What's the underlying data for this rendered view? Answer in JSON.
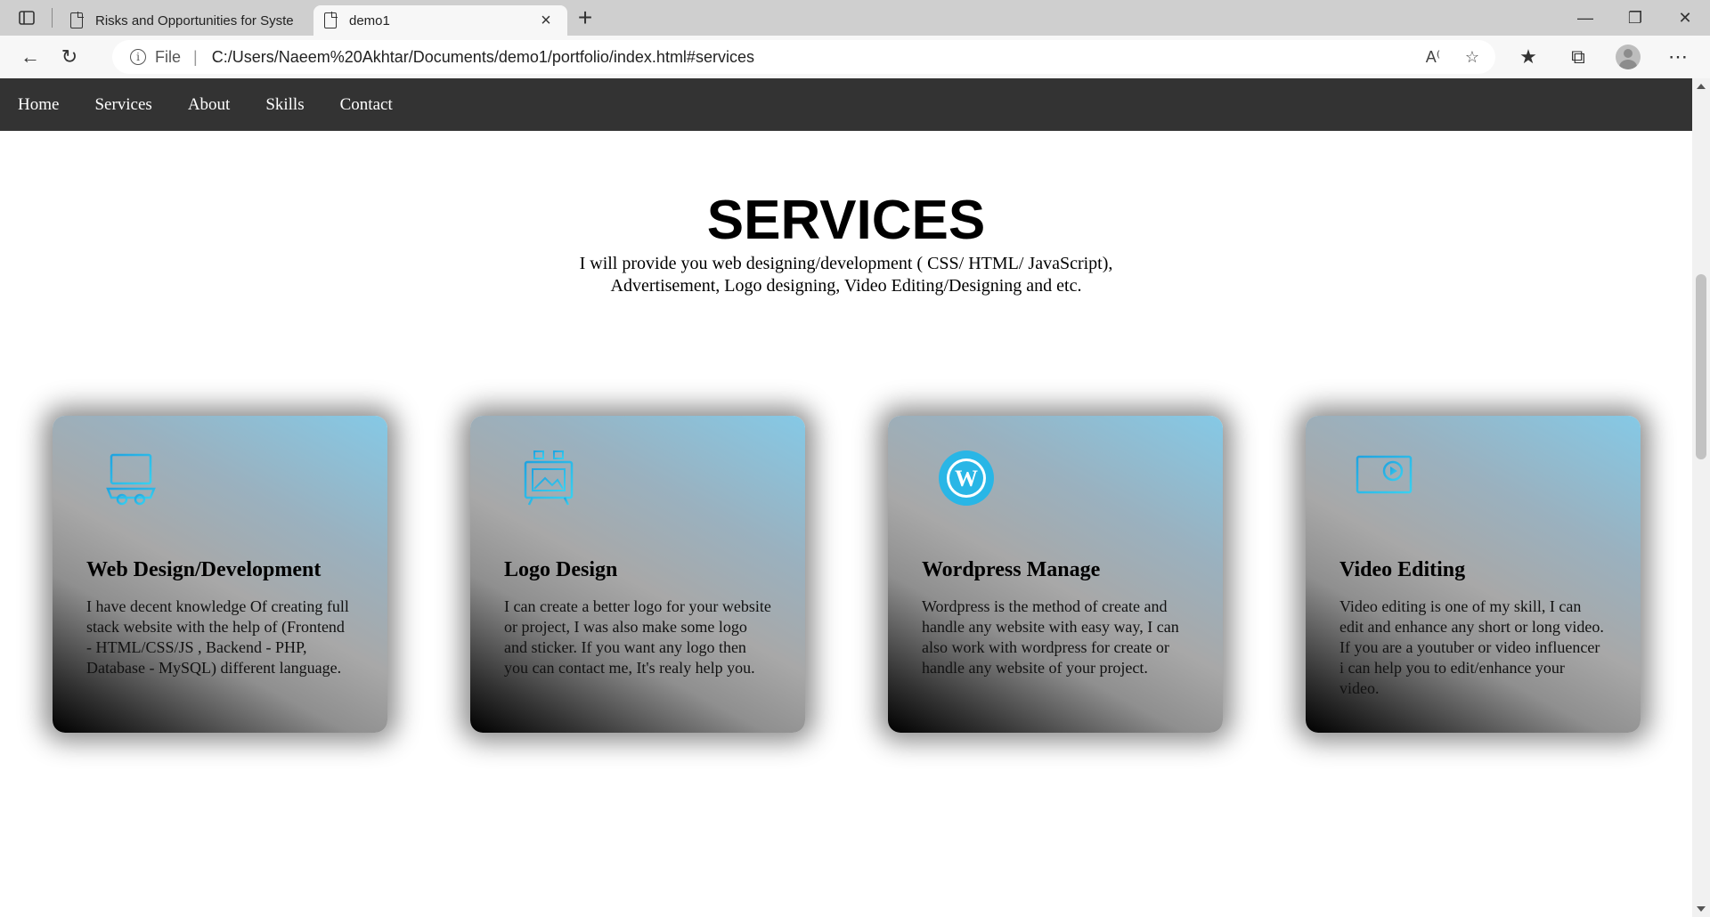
{
  "browser": {
    "tabs": [
      {
        "title": "Risks and Opportunities for Syste",
        "active": false
      },
      {
        "title": "demo1",
        "active": true
      }
    ],
    "address": {
      "scheme_label": "File",
      "url": "C:/Users/Naeem%20Akhtar/Documents/demo1/portfolio/index.html#services"
    }
  },
  "nav": {
    "items": [
      "Home",
      "Services",
      "About",
      "Skills",
      "Contact"
    ]
  },
  "services": {
    "title": "SERVICES",
    "subtitle": "I will provide you web designing/development ( CSS/ HTML/ JavaScript), Advertisement, Logo designing, Video Editing/Designing and etc.",
    "cards": [
      {
        "icon": "web-development-icon",
        "title": "Web Design/Development",
        "text": "I have decent knowledge Of creating full stack website with the help of (Frontend - HTML/CSS/JS , Backend - PHP, Database - MySQL) different language."
      },
      {
        "icon": "logo-design-icon",
        "title": "Logo Design",
        "text": "I can create a better logo for your website or project, I was also make some logo and sticker. If you want any logo then you can contact me, It's realy help you."
      },
      {
        "icon": "wordpress-icon",
        "title": "Wordpress Manage",
        "text": "Wordpress is the method of create and handle any website with easy way, I can also work with wordpress for create or handle any website of your project."
      },
      {
        "icon": "video-editing-icon",
        "title": "Video Editing",
        "text": "Video editing is one of my skill, I can edit and enhance any short or long video. If you are a youtuber or video influencer i can help you to edit/enhance your video."
      }
    ]
  },
  "colors": {
    "nav_bg": "#333333",
    "accent_icon": "#29b6e6"
  }
}
